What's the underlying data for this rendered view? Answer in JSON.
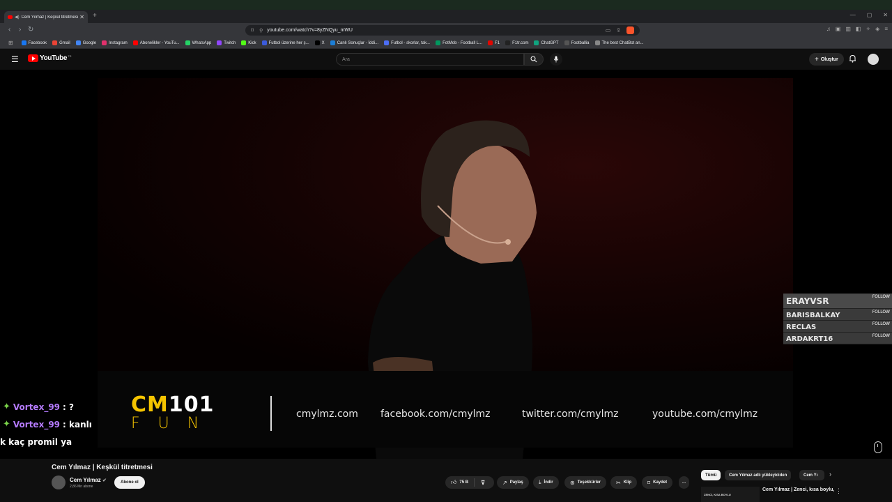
{
  "browser": {
    "tab_title": "Cem Yılmaz | Keşkül titretmesi",
    "url": "youtube.com/watch?v=8yZNQyu_mWU",
    "bookmarks": [
      {
        "label": "Facebook",
        "color": "#1877f2"
      },
      {
        "label": "Gmail",
        "color": "#ea4335"
      },
      {
        "label": "Google",
        "color": "#4285f4"
      },
      {
        "label": "Instagram",
        "color": "#e1306c"
      },
      {
        "label": "Abonelikler - YouTu...",
        "color": "#ff0000"
      },
      {
        "label": "WhatsApp",
        "color": "#25d366"
      },
      {
        "label": "Twitch",
        "color": "#9146ff"
      },
      {
        "label": "Kick",
        "color": "#53fc18"
      },
      {
        "label": "Futbol üzerine her ş...",
        "color": "#3b5bdb"
      },
      {
        "label": "X",
        "color": "#000000"
      },
      {
        "label": "Canlı Sonuçlar - İddi...",
        "color": "#1c7ed6"
      },
      {
        "label": "Futbol - skorlar, tak...",
        "color": "#4c6ef5"
      },
      {
        "label": "FotMob - Football L...",
        "color": "#00985f"
      },
      {
        "label": "F1",
        "color": "#e10600"
      },
      {
        "label": "F1tr.com",
        "color": "#222222"
      },
      {
        "label": "ChatGPT",
        "color": "#10a37f"
      },
      {
        "label": "Footballia",
        "color": "#555555"
      },
      {
        "label": "The best ChatBot an...",
        "color": "#888888"
      }
    ]
  },
  "youtube": {
    "logo_text": "YouTube",
    "country_code": "TR",
    "search_placeholder": "Ara",
    "create_label": "Oluştur",
    "accent": "#ff0000"
  },
  "overlay": {
    "brand_cm": "CM",
    "brand_num": "101",
    "brand_fun": "FUN",
    "sites": [
      "cmylmz.com",
      "facebook.com/cmylmz",
      "twitter.com/cmylmz",
      "youtube.com/cmylmz"
    ],
    "follows": [
      {
        "name": "ERAYVSR",
        "label": "FOLLOW"
      },
      {
        "name": "BARISBALKAY",
        "label": "FOLLOW"
      },
      {
        "name": "RECLAS",
        "label": "FOLLOW"
      },
      {
        "name": "ARDAKRT16",
        "label": "FOLLOW"
      }
    ],
    "chat": [
      {
        "user": "Vortex_99",
        "message": ": ?"
      },
      {
        "user": "Vortex_99",
        "message": ": kanlı"
      },
      {
        "user": "",
        "message": "k kaç promil ya"
      }
    ]
  },
  "video": {
    "title": "Cem Yılmaz | Keşkül titretmesi",
    "channel": "Cem Yılmaz",
    "subscribers": "2,86 Mn abone",
    "subscribe_label": "Abone ol",
    "likes": "75 B",
    "share_label": "Paylaş",
    "download_label": "İndir",
    "thanks_label": "Teşekkürler",
    "clip_label": "Klip",
    "save_label": "Kaydet",
    "more_label": "..."
  },
  "sidebar": {
    "chips": [
      "Tümü",
      "Cem Yılmaz adlı yükleyiciden",
      "Cem Yı"
    ],
    "rec_thumb_text": "ZENCİ, KISA BOYLU",
    "rec_title": "Cem Yılmaz | Zenci, kısa boylu,"
  }
}
